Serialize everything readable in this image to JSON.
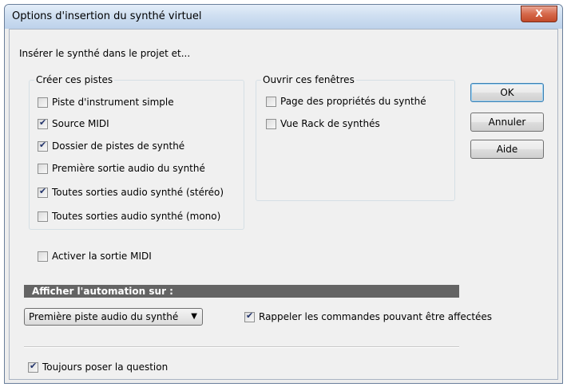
{
  "window": {
    "title": "Options d'insertion du synthé virtuel",
    "close_icon": "x-icon",
    "close_glyph": "X"
  },
  "intro_text": "Insérer le synthé dans le projet et...",
  "create_tracks": {
    "label": "Créer ces pistes",
    "items": [
      {
        "label": "Piste d'instrument simple",
        "checked": false
      },
      {
        "label": "Source MIDI",
        "checked": true
      },
      {
        "label": "Dossier de pistes de synthé",
        "checked": true
      },
      {
        "label": "Première sortie audio du synthé",
        "checked": false
      },
      {
        "label": "Toutes sorties audio synthé (stéréo)",
        "checked": true
      },
      {
        "label": "Toutes sorties audio synthé (mono)",
        "checked": false
      }
    ]
  },
  "open_windows": {
    "label": "Ouvrir ces fenêtres",
    "items": [
      {
        "label": "Page des propriétés du synthé",
        "checked": false
      },
      {
        "label": "Vue Rack de synthés",
        "checked": false
      }
    ]
  },
  "buttons": {
    "ok": "OK",
    "cancel": "Annuler",
    "help": "Aide"
  },
  "midi_output": {
    "label": "Activer la sortie MIDI",
    "checked": false
  },
  "automation": {
    "header": "Afficher l'automation sur :",
    "selected": "Première piste audio du synthé",
    "dropdown_icon": "triangle-down"
  },
  "recall_controls": {
    "label": "Rappeler les commandes pouvant être affectées",
    "checked": true
  },
  "always_ask": {
    "label": "Toujours poser la question",
    "checked": true
  }
}
